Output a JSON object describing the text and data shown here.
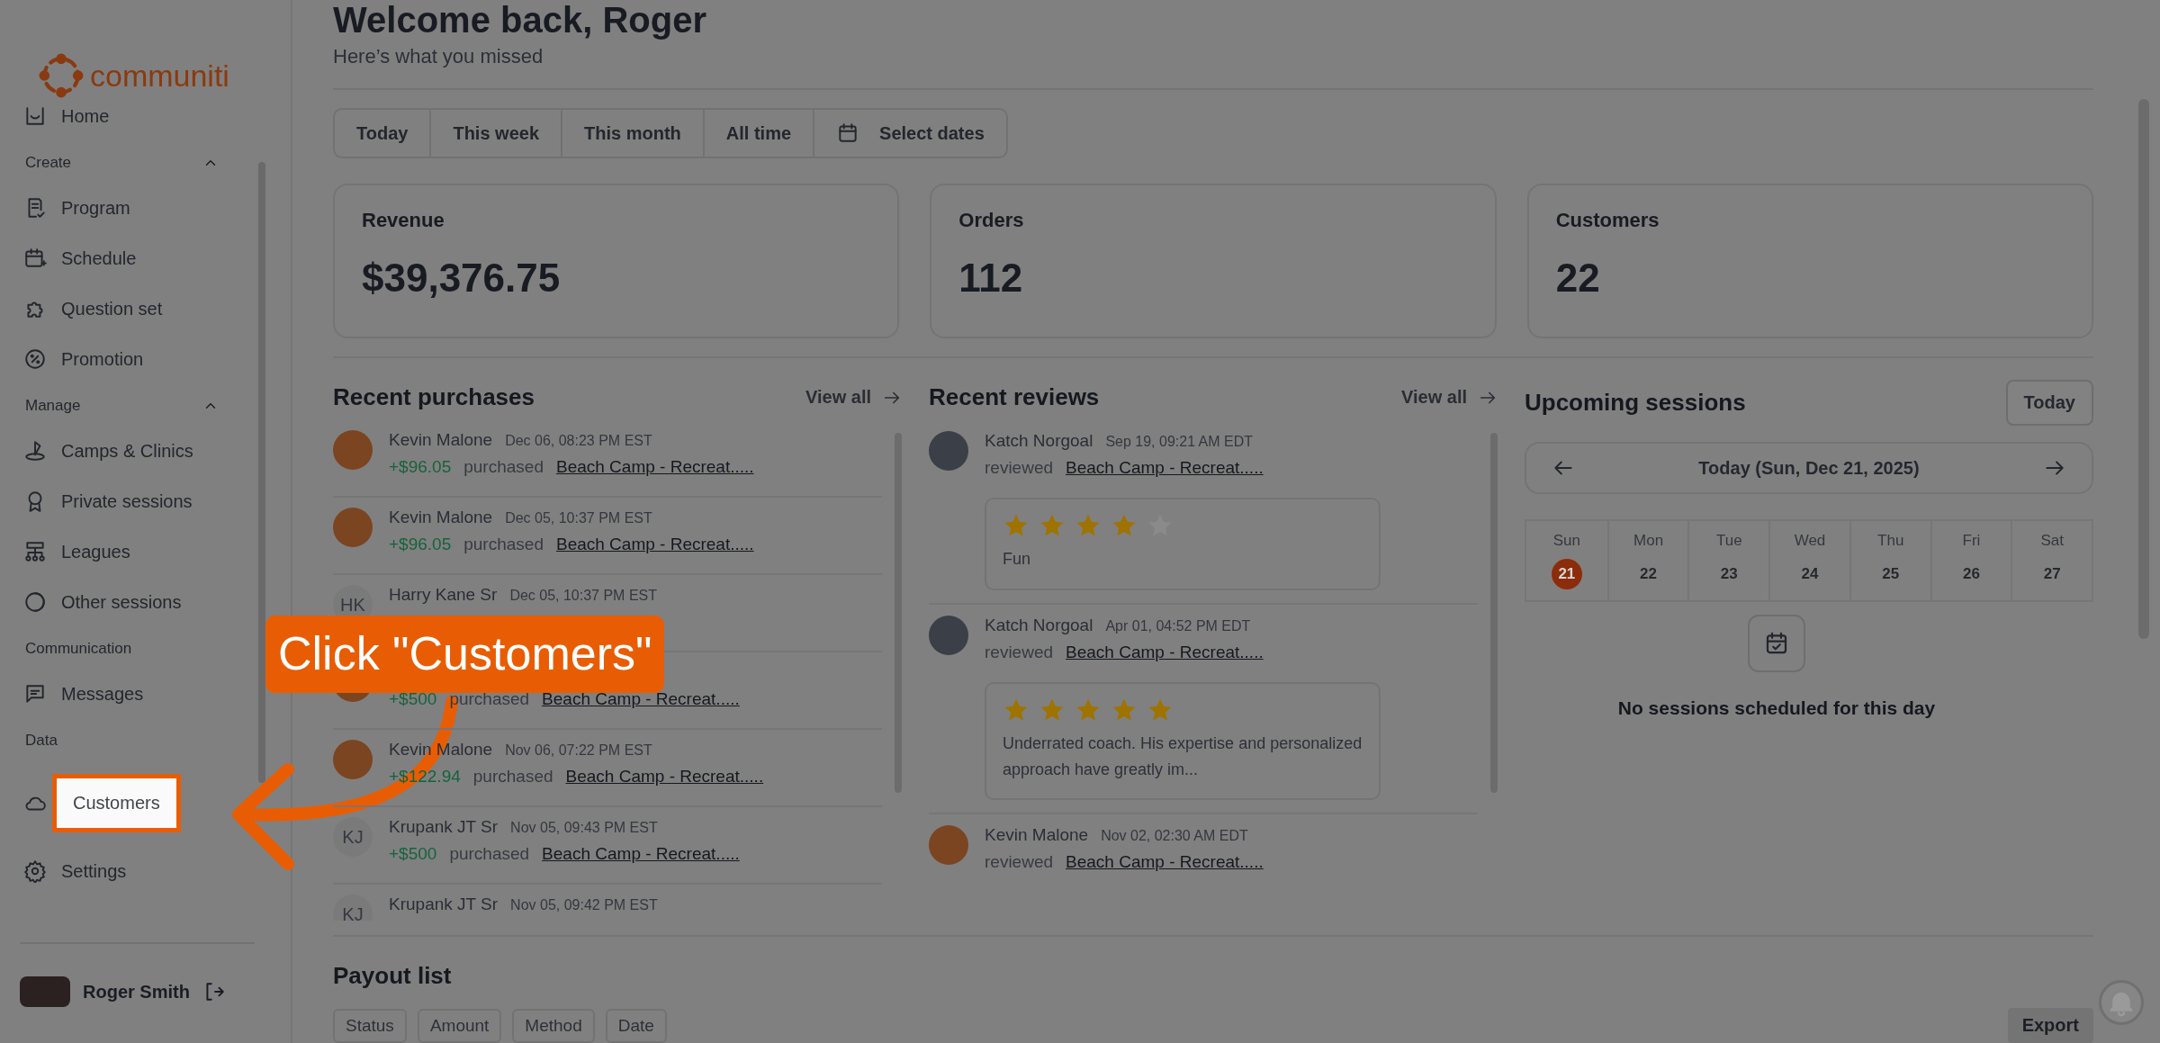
{
  "sidebar": {
    "logo": "communiti",
    "sections": [
      {
        "items": [
          {
            "label": "Home",
            "highlighted": false
          }
        ]
      },
      {
        "title": "Create",
        "expanded": true,
        "items": [
          {
            "label": "Program",
            "highlighted": false
          },
          {
            "label": "Schedule",
            "highlighted": false
          },
          {
            "label": "Question set",
            "highlighted": false
          },
          {
            "label": "Promotion",
            "highlighted": false
          }
        ]
      },
      {
        "title": "Manage",
        "expanded": true,
        "items": [
          {
            "label": "Camps & Clinics",
            "highlighted": false
          },
          {
            "label": "Private sessions",
            "highlighted": false
          },
          {
            "label": "Leagues",
            "highlighted": false
          },
          {
            "label": "Other sessions",
            "highlighted": false
          }
        ]
      },
      {
        "title": "Communication",
        "items": [
          {
            "label": "Messages",
            "highlighted": false
          }
        ]
      },
      {
        "title": "Data",
        "items": [
          {
            "label": "Customers",
            "highlighted": true
          }
        ]
      },
      {
        "items": [
          {
            "label": "Settings",
            "highlighted": false
          }
        ]
      }
    ],
    "user": {
      "name": "Roger Smith"
    }
  },
  "main": {
    "title": "Welcome back, Roger",
    "subtitle": "Here’s what you missed",
    "date_filters": [
      {
        "label": "Today",
        "kind": "plain"
      },
      {
        "label": "This week",
        "kind": "plain"
      },
      {
        "label": "This month",
        "kind": "plain"
      },
      {
        "label": "All time",
        "kind": "plain"
      },
      {
        "label": "Select dates",
        "kind": "picker"
      }
    ],
    "stats": [
      {
        "label": "Revenue",
        "value": "$39,376.75"
      },
      {
        "label": "Orders",
        "value": "112"
      },
      {
        "label": "Customers",
        "value": "22"
      }
    ],
    "recent_purchases": {
      "title": "Recent purchases",
      "view_all": "View all",
      "rows": [
        {
          "avatar": {
            "kind": "photo"
          },
          "name": "Kevin Malone",
          "time": "Dec 06, 08:23 PM EST",
          "amount": "+$96.05",
          "action": "purchased",
          "item": "Beach Camp - Recreat....."
        },
        {
          "avatar": {
            "kind": "photo"
          },
          "name": "Kevin Malone",
          "time": "Dec 05, 10:37 PM EST",
          "amount": "+$96.05",
          "action": "purchased",
          "item": "Beach Camp - Recreat....."
        },
        {
          "avatar": {
            "kind": "initials",
            "text": "HK"
          },
          "name": "Harry Kane Sr",
          "time": "Dec 05, 10:37 PM EST"
        },
        {
          "avatar": {
            "kind": "photo"
          },
          "amount": "+$500",
          "action": "purchased",
          "item": "Beach Camp - Recreat....."
        },
        {
          "avatar": {
            "kind": "photo"
          },
          "name": "Kevin Malone",
          "time": "Nov 06, 07:22 PM EST",
          "amount": "+$122.94",
          "action": "purchased",
          "item": "Beach Camp - Recreat....."
        },
        {
          "avatar": {
            "kind": "initials",
            "text": "KJ"
          },
          "name": "Krupank JT Sr",
          "time": "Nov 05, 09:43 PM EST",
          "amount": "+$500",
          "action": "purchased",
          "item": "Beach Camp - Recreat....."
        },
        {
          "avatar": {
            "kind": "initials",
            "text": "KJ"
          },
          "name": "Krupank JT Sr",
          "time": "Nov 05, 09:42 PM EST"
        }
      ]
    },
    "recent_reviews": {
      "title": "Recent reviews",
      "view_all": "View all",
      "rows": [
        {
          "name": "Katch Norgoal",
          "time": "Sep 19, 09:21 AM EDT",
          "action": "reviewed",
          "item": "Beach Camp - Recreat.....",
          "stars": 4,
          "comment": "Fun"
        },
        {
          "name": "Katch Norgoal",
          "time": "Apr 01, 04:52 PM EDT",
          "action": "reviewed",
          "item": "Beach Camp - Recreat.....",
          "stars": 5,
          "comment": "Underrated coach. His expertise and personalized approach have greatly im..."
        },
        {
          "name": "Kevin Malone",
          "time": "Nov 02, 02:30 AM EDT",
          "action": "reviewed",
          "item": "Beach Camp - Recreat....."
        }
      ]
    },
    "upcoming_sessions": {
      "title": "Upcoming sessions",
      "today_button": "Today",
      "date_label": "Today (Sun, Dec 21, 2025)",
      "days": [
        {
          "name": "Sun",
          "date": "21",
          "selected": true
        },
        {
          "name": "Mon",
          "date": "22",
          "selected": false
        },
        {
          "name": "Tue",
          "date": "23",
          "selected": false
        },
        {
          "name": "Wed",
          "date": "24",
          "selected": false
        },
        {
          "name": "Thu",
          "date": "25",
          "selected": false
        },
        {
          "name": "Fri",
          "date": "26",
          "selected": false
        },
        {
          "name": "Sat",
          "date": "27",
          "selected": false
        }
      ],
      "empty_text": "No sessions scheduled for this day"
    },
    "payout_list": {
      "title": "Payout list",
      "filters": [
        "Status",
        "Amount",
        "Method",
        "Date"
      ],
      "export": "Export"
    }
  },
  "callout": {
    "text": "Click \"Customers\""
  }
}
